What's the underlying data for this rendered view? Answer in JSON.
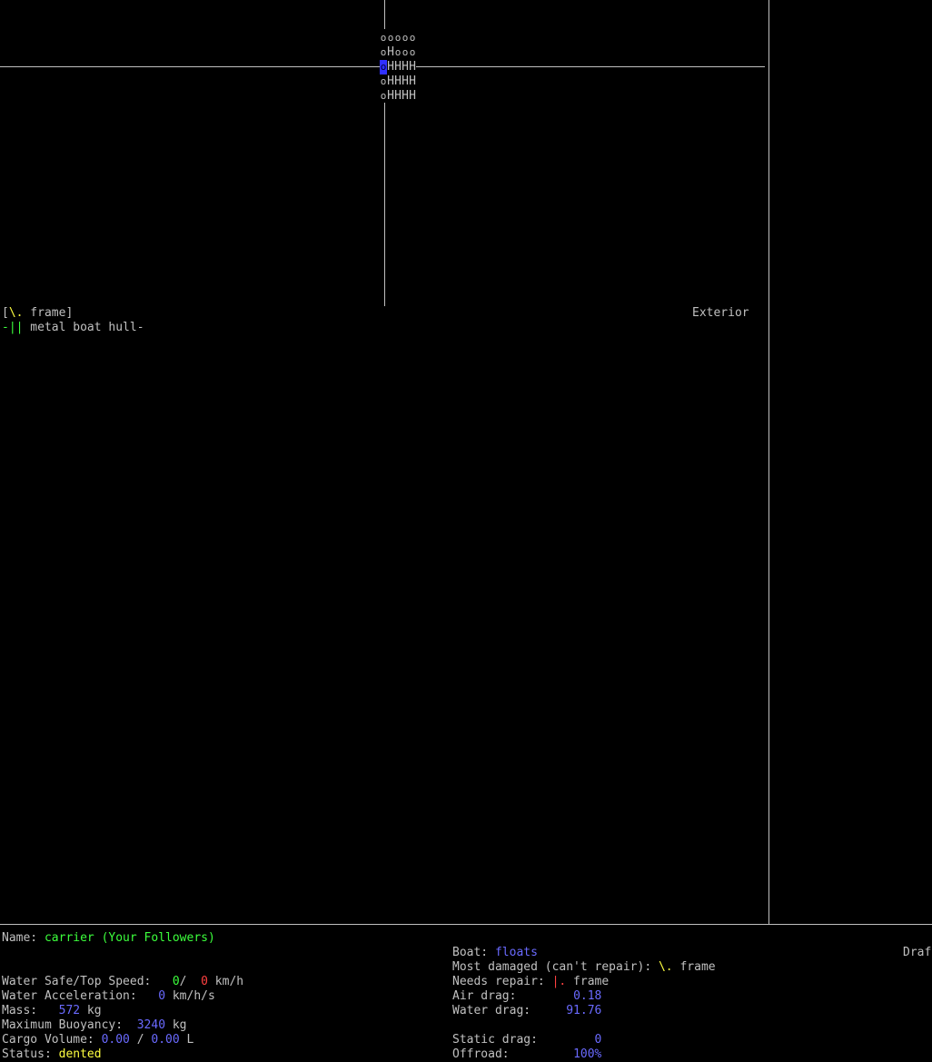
{
  "vehicle_grid": {
    "rows": [
      "ooooo",
      "oHooo",
      "oHHHH",
      "oHHHH",
      "oHHHH"
    ],
    "selected": {
      "row": 2,
      "col": 0
    }
  },
  "parts_panel": {
    "frame_label_open": "[",
    "frame_symbol": "\\.",
    "frame_label_text": " frame]",
    "location": "Exterior",
    "hull_prefix": "-||",
    "hull_label": " metal boat hull-"
  },
  "info": {
    "name_label": "Name: ",
    "name_value": "carrier (Your Followers)",
    "drafted_label": "Draf",
    "boat_label": "Boat: ",
    "boat_value": "floats",
    "most_damaged_label": "Most damaged (can't repair): ",
    "most_damaged_symbol": "\\.",
    "most_damaged_part": " frame",
    "needs_repair_label": "Needs repair: ",
    "needs_repair_symbol": "|.",
    "needs_repair_part": " frame",
    "air_drag_label": "Air drag:        ",
    "air_drag_value": "0.18",
    "water_drag_label": "Water drag:     ",
    "water_drag_value": "91.76",
    "static_drag_label": "Static drag:        ",
    "static_drag_value": "0",
    "offroad_label": "Offroad:         ",
    "offroad_value": "100%",
    "water_speed_label": "Water Safe/Top Speed:   ",
    "water_speed_safe": "0",
    "water_speed_sep": "/  ",
    "water_speed_top": "0",
    "water_speed_unit": " km/h",
    "water_accel_label": "Water Acceleration:   ",
    "water_accel_value": "0",
    "water_accel_unit": " km/h/s",
    "mass_label": "Mass:   ",
    "mass_value": "572",
    "mass_unit": " kg",
    "buoyancy_label": "Maximum Buoyancy:  ",
    "buoyancy_value": "3240",
    "buoyancy_unit": " kg",
    "cargo_label": "Cargo Volume: ",
    "cargo_used": "0.00",
    "cargo_sep": " / ",
    "cargo_total": "0.00",
    "cargo_unit": " L",
    "status_label": "Status: ",
    "status_value": "dented"
  }
}
